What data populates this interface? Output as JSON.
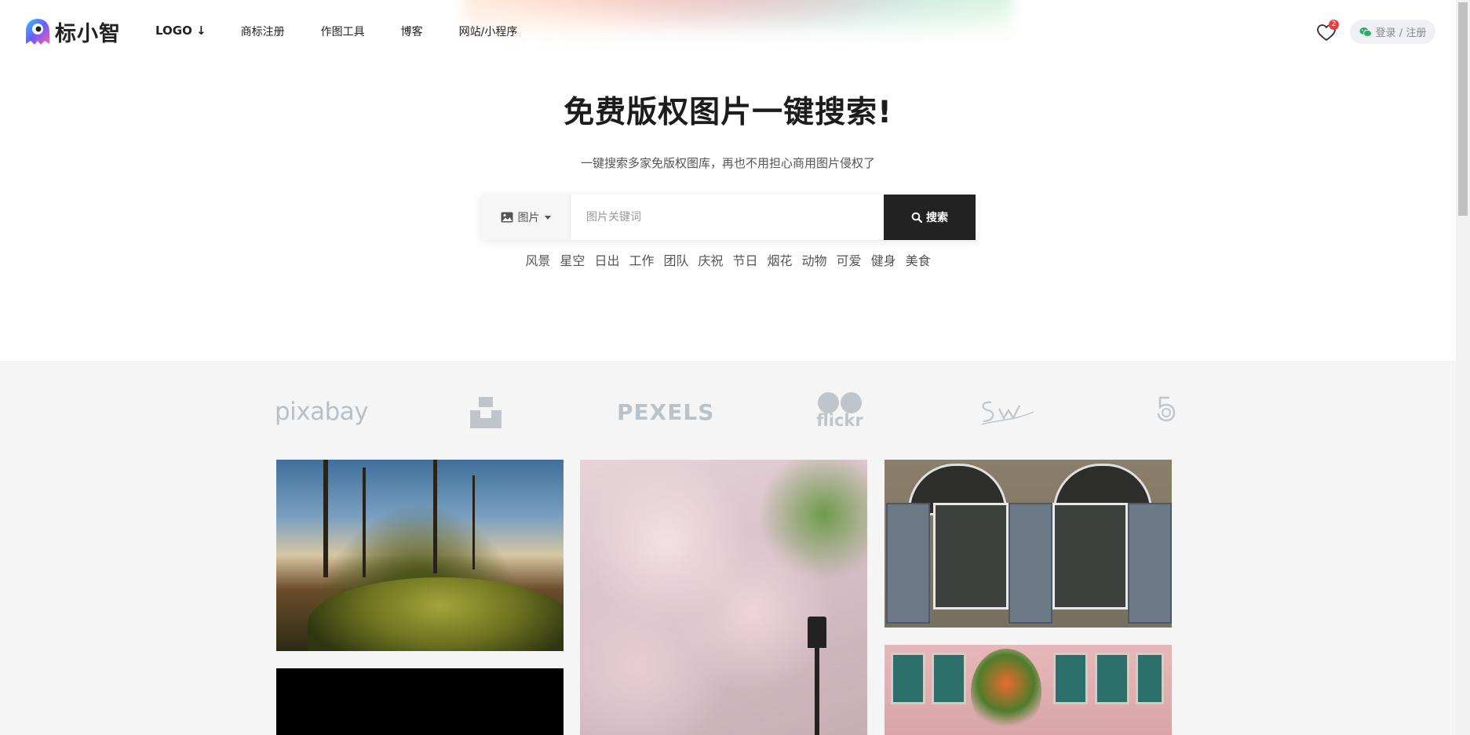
{
  "brand": {
    "name": "标小智"
  },
  "nav": [
    {
      "label": "LOGO ↓"
    },
    {
      "label": "商标注册"
    },
    {
      "label": "作图工具"
    },
    {
      "label": "博客"
    },
    {
      "label": "网站/小程序"
    }
  ],
  "header": {
    "favorites_count": "2",
    "login_label": "登录 / 注册"
  },
  "hero": {
    "title": "免费版权图片一键搜索!",
    "subtitle": "一键搜索多家免版权图库，再也不用担心商用图片侵权了"
  },
  "search": {
    "type_label": "图片",
    "placeholder": "图片关键词",
    "button_label": "搜索"
  },
  "tags": [
    "风景",
    "星空",
    "日出",
    "工作",
    "团队",
    "庆祝",
    "节日",
    "烟花",
    "动物",
    "可爱",
    "健身",
    "美食"
  ],
  "sources": {
    "pixabay": "pixabay",
    "pexels": "PEXELS",
    "flickr": "flickr"
  },
  "colors": {
    "search_button_bg": "#222222",
    "gallery_bg": "#f5f5f5",
    "badge": "#f23a3a",
    "wechat_green": "#2aae67"
  }
}
